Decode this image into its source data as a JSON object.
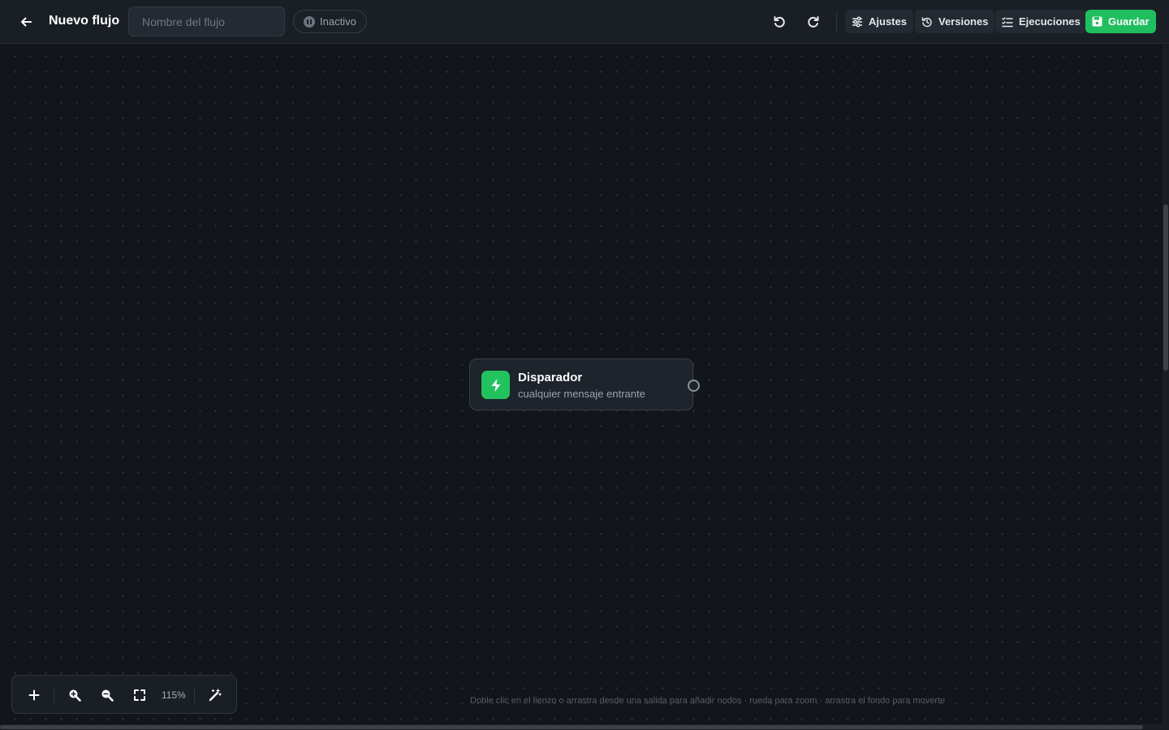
{
  "header": {
    "back_icon": "arrow-left-icon",
    "title": "Nuevo flujo",
    "name_input": {
      "value": "",
      "placeholder": "Nombre del flujo"
    },
    "status": {
      "label": "Inactivo",
      "icon": "pause-circle-icon"
    },
    "undo_icon": "undo-icon",
    "redo_icon": "redo-icon",
    "buttons": {
      "settings": {
        "label": "Ajustes",
        "icon": "sliders-icon"
      },
      "versions": {
        "label": "Versiones",
        "icon": "history-icon"
      },
      "executions": {
        "label": "Ejecuciones",
        "icon": "list-checks-icon"
      },
      "save": {
        "label": "Guardar",
        "icon": "save-icon",
        "color": "#1fbf5f"
      }
    }
  },
  "canvas": {
    "nodes": [
      {
        "title": "Disparador",
        "subtitle": "cualquier mensaje entrante",
        "icon": "lightning-bolt-icon",
        "icon_color": "#22c35e"
      }
    ],
    "hint": "Doble clic en el lienzo o arrastra desde una salida para añadir nodos · rueda para zoom · arrastra el fondo para moverte"
  },
  "toolbar": {
    "add_icon": "plus-icon",
    "zoom_in_icon": "zoom-in-icon",
    "zoom_out_icon": "zoom-out-icon",
    "fit_icon": "fit-screen-icon",
    "zoom_level": "115%",
    "auto_layout_icon": "magic-wand-icon"
  }
}
